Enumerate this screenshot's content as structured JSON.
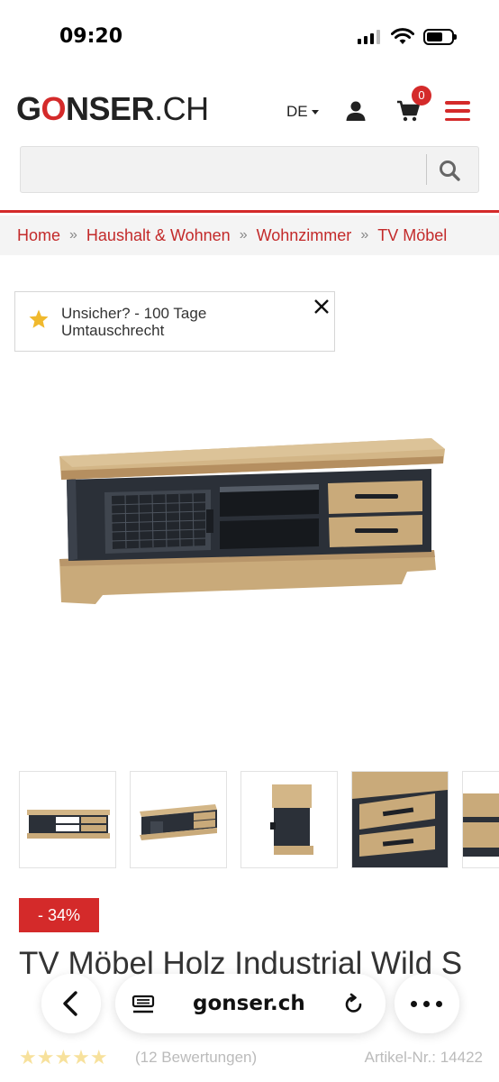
{
  "status_bar": {
    "time": "09:20"
  },
  "header": {
    "logo": {
      "pre": "G",
      "o": "O",
      "brand_rest": "NSER",
      "tld": ".CH"
    },
    "language": "DE",
    "cart_count": "0",
    "search": {
      "placeholder": ""
    }
  },
  "breadcrumb": {
    "items": [
      "Home",
      "Haushalt & Wohnen",
      "Wohnzimmer",
      "TV Möbel"
    ],
    "separator": "»"
  },
  "notice": {
    "text": "Unsicher? - 100 Tage Umtauschrecht"
  },
  "product": {
    "discount": "- 34%",
    "title": "TV Möbel Holz Industrial Wild S",
    "rating_stars": 5,
    "reviews": "(12 Bewertungen)",
    "article": "Artikel-Nr.: 14422",
    "thumbnail_count": 5
  },
  "browser": {
    "url": "gonser.ch"
  },
  "colors": {
    "accent": "#d42a2a",
    "wood": "#c9aa7a",
    "metal": "#2b3038"
  }
}
